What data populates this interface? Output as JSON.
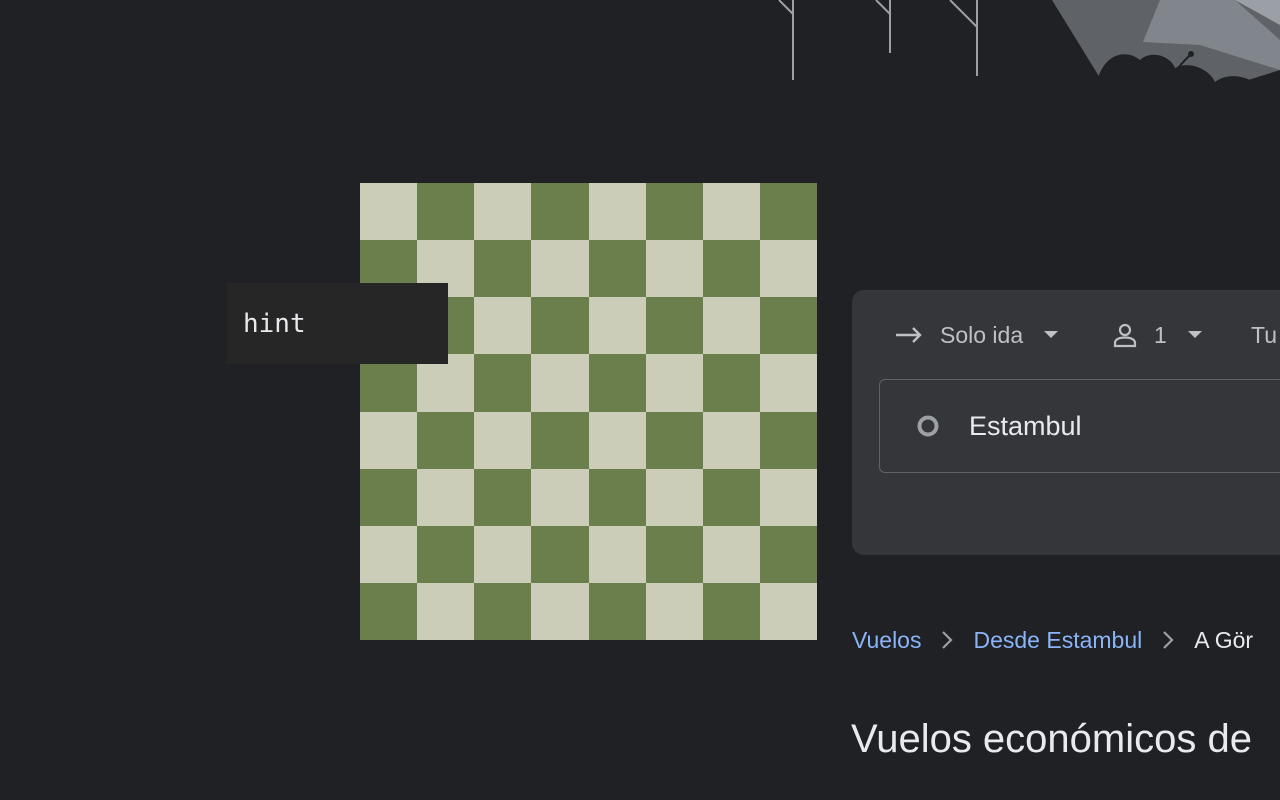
{
  "hint": {
    "label": "hint"
  },
  "chessboard": {
    "light_color": "#cbcdb8",
    "dark_color": "#6a7f4b",
    "rows": 8,
    "cols": 8
  },
  "search": {
    "trip_type": "Solo ida",
    "passengers": "1",
    "cabin_class": "Tu",
    "origin": "Estambul"
  },
  "breadcrumb": {
    "items": [
      {
        "label": "Vuelos"
      },
      {
        "label": "Desde Estambul"
      },
      {
        "label": "A Gör"
      }
    ]
  },
  "page": {
    "title": "Vuelos económicos de"
  },
  "colors": {
    "background": "#202124",
    "card": "#35363a",
    "link": "#8ab4f8",
    "text": "#e8eaed",
    "muted": "#bdc1c6"
  }
}
